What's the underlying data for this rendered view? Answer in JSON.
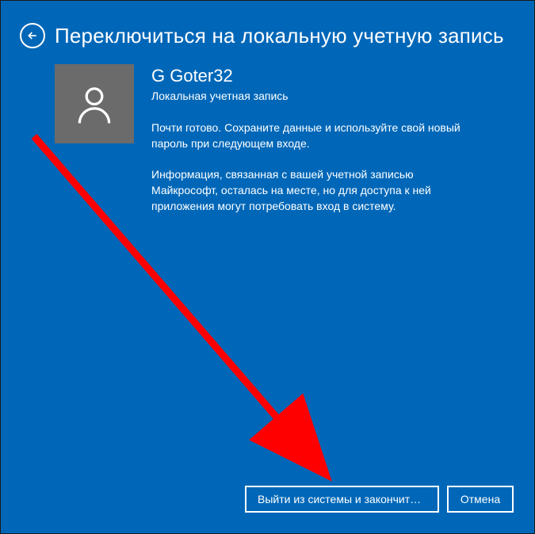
{
  "header": {
    "title": "Переключиться на локальную учетную запись"
  },
  "user": {
    "username": "G Goter32",
    "account_type": "Локальная учетная запись"
  },
  "messages": {
    "line1": "Почти готово. Сохраните данные и используйте свой новый пароль при следующем входе.",
    "line2": "Информация, связанная с вашей учетной записью Майкрософт, осталась на месте, но для доступа к ней приложения могут потребовать вход в систему."
  },
  "buttons": {
    "primary": "Выйти из системы и закончить р...",
    "secondary": "Отмена"
  }
}
